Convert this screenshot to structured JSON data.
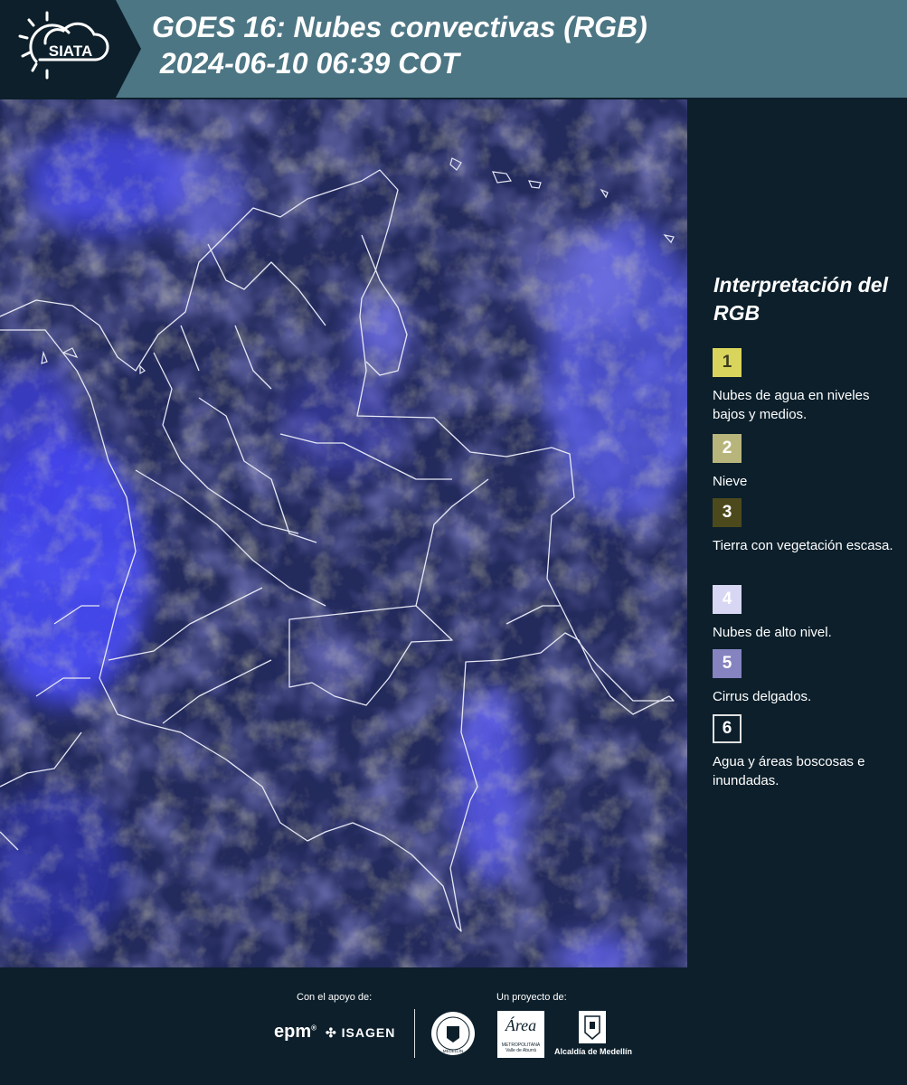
{
  "header": {
    "logo_text": "SIATA",
    "title_line1": "GOES 16: Nubes convectivas (RGB)",
    "title_line2": " 2024-06-10 06:39 COT",
    "background_color": "#4d7684"
  },
  "legend": {
    "title": "Interpretación del RGB",
    "items": [
      {
        "number": "1",
        "description": "Nubes de agua en niveles bajos y medios.",
        "color": "#d9d55c",
        "text_color": "#3a3a20"
      },
      {
        "number": "2",
        "description": "Nieve",
        "color": "#b8b57c",
        "text_color": "#ffffff"
      },
      {
        "number": "3",
        "description": "Tierra con vegetación escasa.",
        "color": "#4c4a1c",
        "text_color": "#ffffff"
      },
      {
        "number": "4",
        "description": "Nubes de alto nivel.",
        "color": "#d7d6f3",
        "text_color": "#ffffff"
      },
      {
        "number": "5",
        "description": "Cirrus delgados.",
        "color": "#8583c0",
        "text_color": "#ffffff"
      },
      {
        "number": "6",
        "description": "Agua y áreas boscosas e inundadas.",
        "color": "#0c1f2b",
        "text_color": "#ffffff"
      }
    ]
  },
  "footer": {
    "support_label": "Con el apoyo de:",
    "project_label": "Un proyecto de:",
    "sponsors": {
      "epm": "epm",
      "isagen": "ISAGEN",
      "seal": "MEDELLÍN",
      "area_logo": "Área",
      "area_sub1": "METROPOLITANA",
      "area_sub2": "Valle de Aburrá",
      "alcaldia": "Alcaldía de Medellín"
    }
  }
}
